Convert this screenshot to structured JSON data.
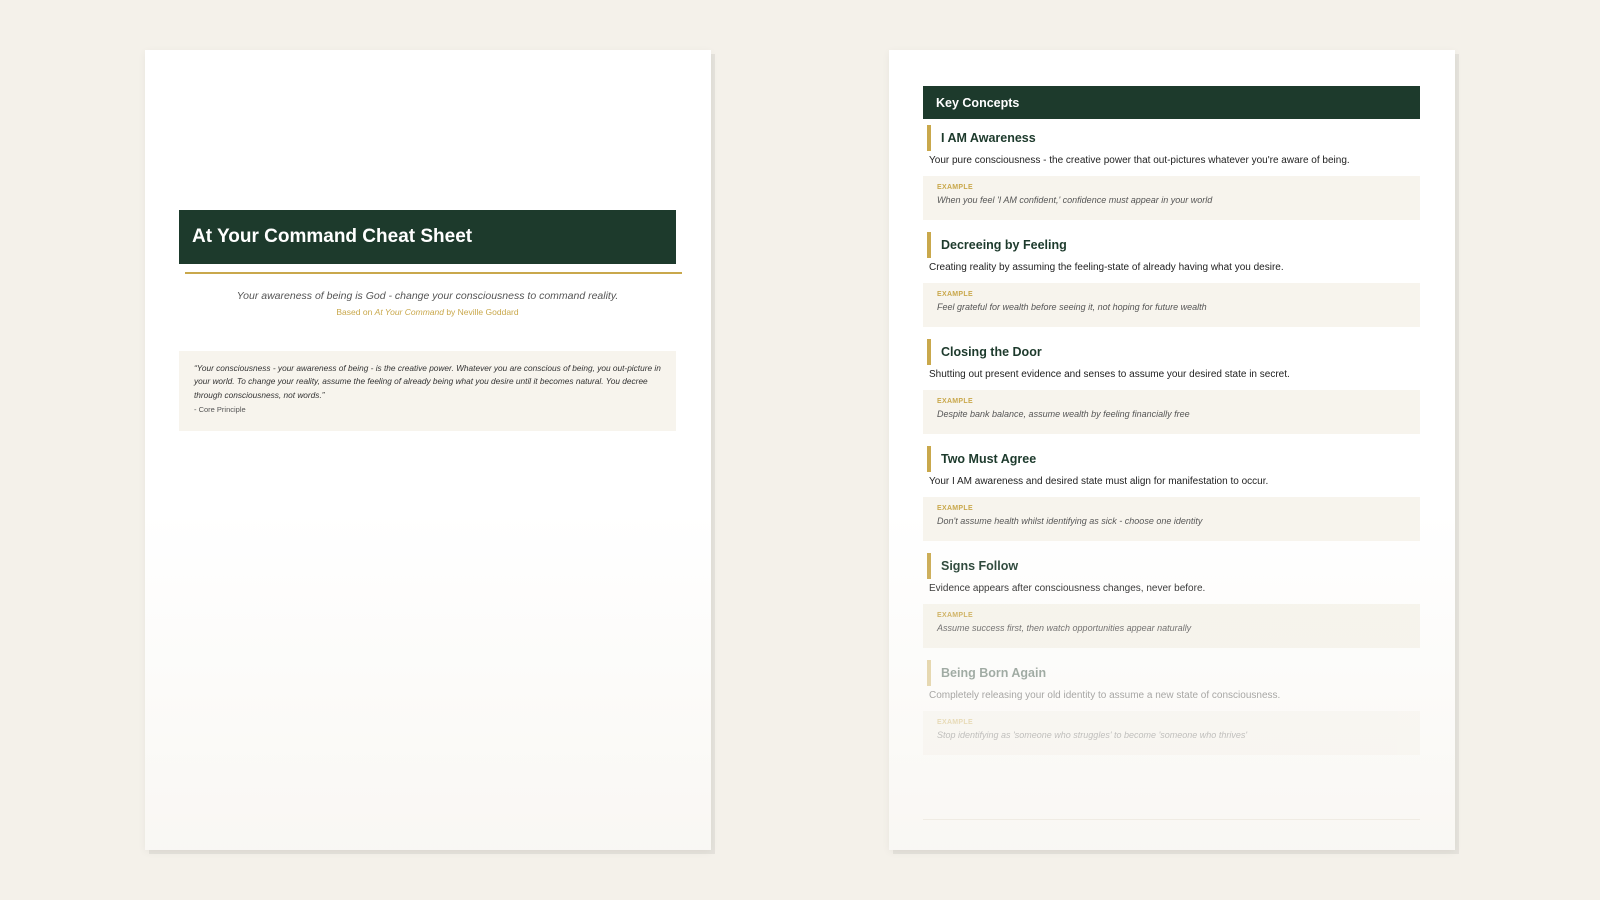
{
  "colors": {
    "background": "#f4f1ea",
    "dark_green": "#1d3a2c",
    "gold": "#c9a84c",
    "box_fill": "#f7f4ed"
  },
  "cover": {
    "title": "At Your Command Cheat Sheet",
    "tagline": "Your awareness of being is God - change your consciousness to command reality.",
    "byline_prefix": "Based on ",
    "byline_book": "At Your Command",
    "byline_suffix": " by Neville Goddard",
    "quote": "“Your consciousness - your awareness of being - is the creative power. Whatever you are conscious of being, you out-picture in your world. To change your reality, assume the feeling of already being what you desire until it becomes natural. You decree through consciousness, not words.”",
    "quote_attribution": "- Core Principle"
  },
  "key_concepts": {
    "header": "Key Concepts",
    "example_label": "EXAMPLE",
    "items": [
      {
        "title": "I AM Awareness",
        "description": "Your pure consciousness - the creative power that out-pictures whatever you're aware of being.",
        "example": "When you feel 'I AM confident,' confidence must appear in your world"
      },
      {
        "title": "Decreeing by Feeling",
        "description": "Creating reality by assuming the feeling-state of already having what you desire.",
        "example": "Feel grateful for wealth before seeing it, not hoping for future wealth"
      },
      {
        "title": "Closing the Door",
        "description": "Shutting out present evidence and senses to assume your desired state in secret.",
        "example": "Despite bank balance, assume wealth by feeling financially free"
      },
      {
        "title": "Two Must Agree",
        "description": "Your I AM awareness and desired state must align for manifestation to occur.",
        "example": "Don't assume health whilst identifying as sick - choose one identity"
      },
      {
        "title": "Signs Follow",
        "description": "Evidence appears after consciousness changes, never before.",
        "example": "Assume success first, then watch opportunities appear naturally"
      },
      {
        "title": "Being Born Again",
        "description": "Completely releasing your old identity to assume a new state of consciousness.",
        "example": "Stop identifying as 'someone who struggles' to become 'someone who thrives'"
      }
    ]
  }
}
